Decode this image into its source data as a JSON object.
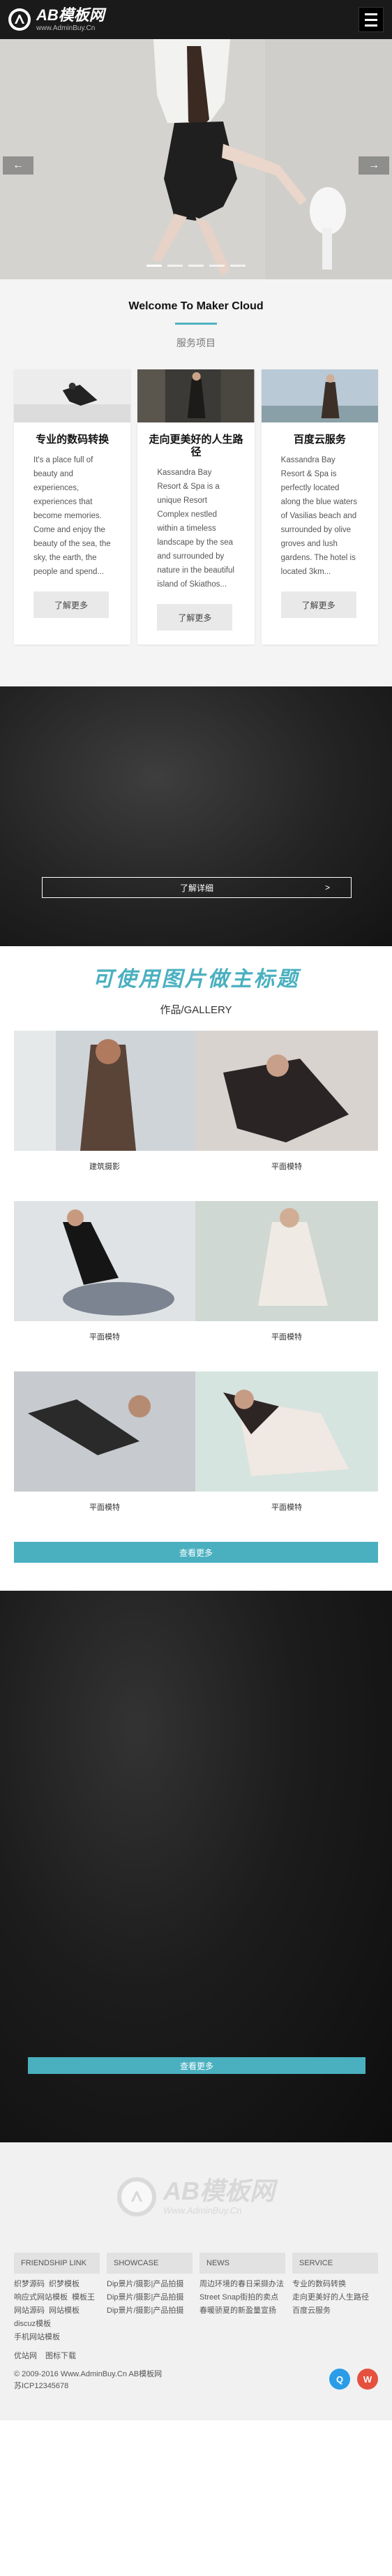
{
  "header": {
    "logo_badge": "AB",
    "logo_title": "AB模板网",
    "logo_sub": "www.AdminBuy.Cn"
  },
  "hero": {
    "prev_icon": "←",
    "next_icon": "→",
    "slides": 5,
    "active_slide": 1
  },
  "services": {
    "title": "Welcome To Maker Cloud",
    "subtitle": "服务项目",
    "accent_color": "#4fb3c3",
    "cards": [
      {
        "title": "专业的数码转换",
        "body": "It's a place full of beauty and experiences, experiences that become memories. Come and enjoy the beauty of the sea, the sky, the earth, the people and spend...",
        "button": "了解更多"
      },
      {
        "title": "走向更美好的人生路径",
        "body": "Kassandra Bay Resort & Spa is a unique Resort Complex nestled within a timeless landscape by the sea and surrounded by nature in the beautiful island of Skiathos...",
        "button": "了解更多"
      },
      {
        "title": "百度云服务",
        "body": "Kassandra Bay Resort & Spa is perfectly located along the blue waters of Vasilias beach and surrounded by olive groves and lush gardens. The hotel is located 3km...",
        "button": "了解更多"
      }
    ]
  },
  "band": {
    "button": "了解详细",
    "arrow": ">"
  },
  "gallery": {
    "title": "可使用图片做主标题",
    "subtitle": "作品/GALLERY",
    "items": [
      {
        "caption": "建筑摄影"
      },
      {
        "caption": "平面模特"
      },
      {
        "caption": "平面模特"
      },
      {
        "caption": "平面模特"
      },
      {
        "caption": "平面模特"
      },
      {
        "caption": "平面模特"
      }
    ],
    "more": "查看更多"
  },
  "band2": {
    "button": "查看更多"
  },
  "footer": {
    "logo_title": "AB模板网",
    "logo_sub": "Www.AdminBuy.Cn",
    "columns": [
      {
        "head": "FRIENDSHIP LINK",
        "links": [
          "织梦源码",
          "织梦模板",
          "响应式网站模板",
          "模板王",
          "网站源码",
          "网站模板",
          "discuz模板",
          "手机网站模板"
        ]
      },
      {
        "head": "SHOWCASE",
        "links": [
          "Dip景片/摄影|产品拍摄",
          "Dip景片/摄影|产品拍摄",
          "Dip景片/摄影|产品拍摄"
        ]
      },
      {
        "head": "NEWS",
        "links": [
          "周边环境的春日采撷办法",
          "Street Snap街拍的卖点",
          "春暖骄夏的新盈量宣扬"
        ]
      },
      {
        "head": "SERVICE",
        "links": [
          "专业的数码转换",
          "走向更美好的人生路径",
          "百度云服务"
        ]
      }
    ],
    "partner_links": [
      "优站网",
      "图标下载"
    ],
    "copyright": "© 2009-2016 Www.AdminBuy.Cn AB模板网",
    "icp": "苏ICP12345678",
    "social": {
      "qq": "Q",
      "weibo": "W"
    }
  }
}
